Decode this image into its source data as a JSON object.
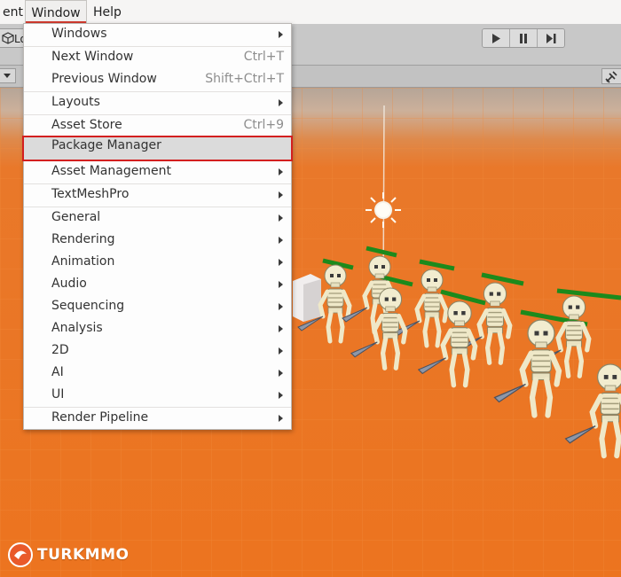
{
  "menubar": {
    "items": [
      "ent",
      "Window",
      "Help"
    ],
    "active_item": "Window",
    "accent_color": "#d43c2f"
  },
  "toolbar": {
    "account_label": "Lo",
    "account_icon": "unity-cube-icon",
    "play_icon": "play-icon",
    "pause_icon": "pause-icon",
    "step_icon": "step-icon"
  },
  "scene_header": {
    "tools_icon": "wrench-icon"
  },
  "window_menu": {
    "items": [
      {
        "label": "Windows",
        "shortcut": "",
        "submenu": true
      },
      {
        "label": "Next Window",
        "shortcut": "Ctrl+T",
        "submenu": false
      },
      {
        "label": "Previous Window",
        "shortcut": "Shift+Ctrl+T",
        "submenu": false
      },
      {
        "label": "Layouts",
        "shortcut": "",
        "submenu": true
      },
      {
        "label": "Asset Store",
        "shortcut": "Ctrl+9",
        "submenu": false
      },
      {
        "label": "Package Manager",
        "shortcut": "",
        "submenu": false,
        "highlighted": true
      },
      {
        "label": "Asset Management",
        "shortcut": "",
        "submenu": true
      },
      {
        "label": "TextMeshPro",
        "shortcut": "",
        "submenu": true
      },
      {
        "label": "General",
        "shortcut": "",
        "submenu": true
      },
      {
        "label": "Rendering",
        "shortcut": "",
        "submenu": true
      },
      {
        "label": "Animation",
        "shortcut": "",
        "submenu": true
      },
      {
        "label": "Audio",
        "shortcut": "",
        "submenu": true
      },
      {
        "label": "Sequencing",
        "shortcut": "",
        "submenu": true
      },
      {
        "label": "Analysis",
        "shortcut": "",
        "submenu": true
      },
      {
        "label": "2D",
        "shortcut": "",
        "submenu": true
      },
      {
        "label": "AI",
        "shortcut": "",
        "submenu": true
      },
      {
        "label": "UI",
        "shortcut": "",
        "submenu": true
      },
      {
        "label": "Render Pipeline",
        "shortcut": "",
        "submenu": true
      }
    ],
    "highlight_border_color": "#d31f1f"
  },
  "scene": {
    "ground_color": "#ec741f",
    "health_bar_color": "#1c8a1c",
    "light_icon": "directional-light-icon"
  },
  "watermark": {
    "text": "TURKMMO",
    "icon": "turkmmo-logo-icon"
  }
}
